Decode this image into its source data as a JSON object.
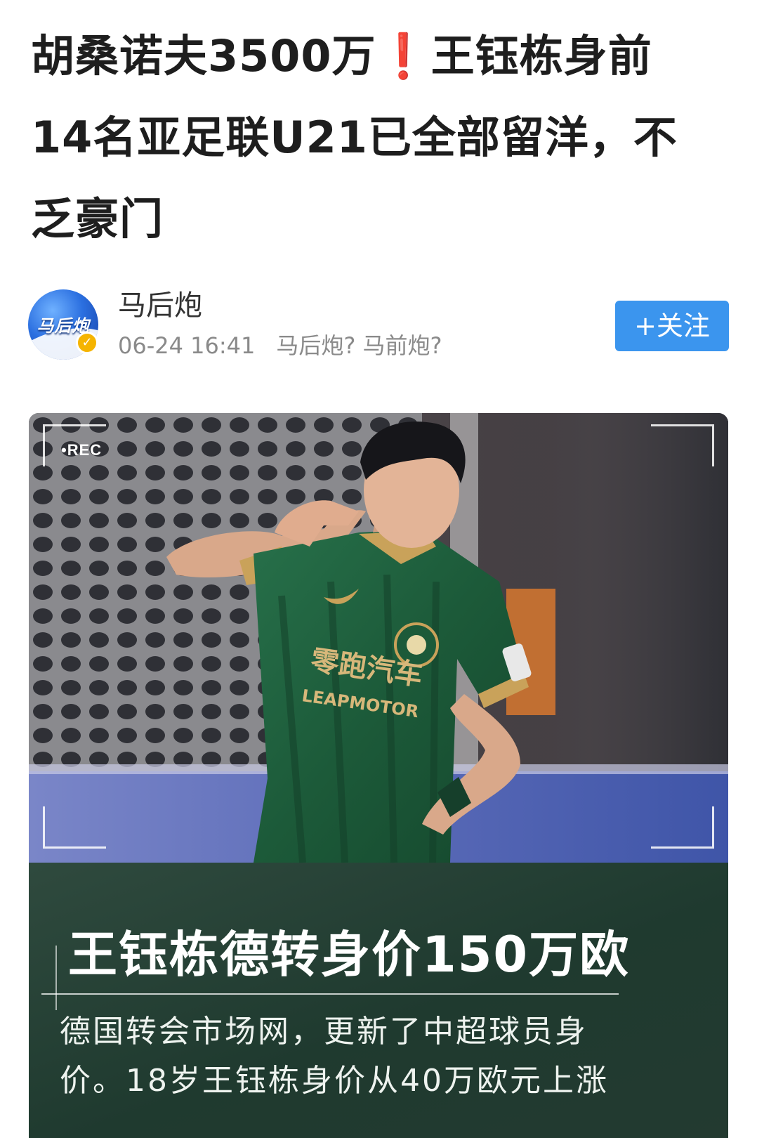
{
  "headline": {
    "line1_text": "胡桑诺夫3500万",
    "line1_mark": "❗",
    "line1_rest": "王钰栋身前",
    "line2": "14名亚足联U21已全部留洋，不",
    "line3": "乏豪门"
  },
  "author": {
    "avatar_text": "马后炮",
    "name": "马后炮",
    "date": "06-24 16:41",
    "tagline": "马后炮? 马前炮?",
    "follow_label": "+关注"
  },
  "card": {
    "rec_label": "•REC",
    "jersey_sponsor_cn": "零跑汽车",
    "jersey_sponsor_en": "LEAPMOTOR",
    "overlay_title": "王钰栋德转身价150万欧",
    "overlay_body_line1": "德国转会市场网，更新了中超球员身",
    "overlay_body_line2": "价。18岁王钰栋身价从40万欧元上涨"
  },
  "colors": {
    "follow_button": "#3b95ee",
    "exclamation": "#e8302a",
    "jersey_green": "#1f5a3a",
    "jersey_gold": "#c9a25a"
  }
}
